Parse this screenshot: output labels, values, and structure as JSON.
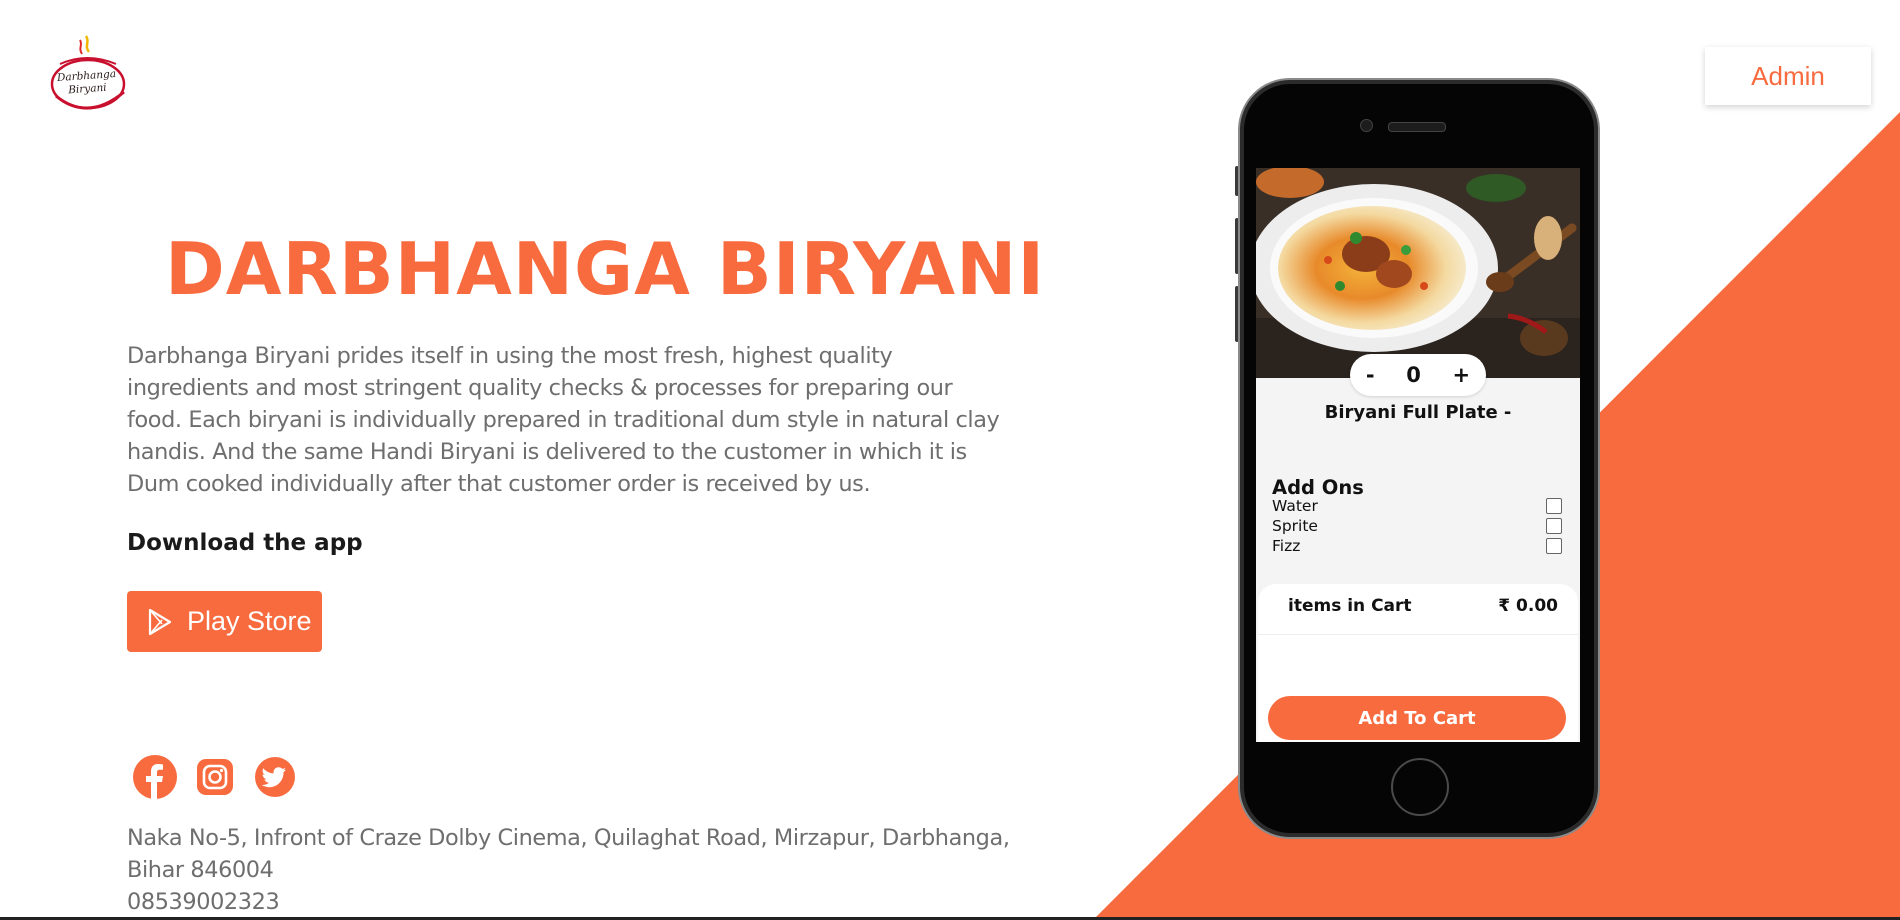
{
  "colors": {
    "accent": "#f86b3f",
    "text_muted": "#6e6e6e",
    "text_dark": "#1a1a1a"
  },
  "logo": {
    "line1": "Darbhanga",
    "line2": "Biryani",
    "icon": "handi-pot-logo"
  },
  "header": {
    "admin_label": "Admin"
  },
  "hero": {
    "title": "DARBHANGA BIRYANI",
    "description": "Darbhanga Biryani prides itself in using the most fresh, highest quality ingredients and most stringent quality checks & processes for preparing our food. Each biryani is individually prepared in traditional dum style in natural clay handis. And the same Handi Biryani is delivered to the customer in which it is Dum cooked individually after that customer order is received by us.",
    "download_label": "Download the app",
    "play_store_label": "Play Store",
    "play_store_icon": "play-store-icon"
  },
  "socials": [
    {
      "name": "facebook",
      "icon": "facebook-icon"
    },
    {
      "name": "instagram",
      "icon": "instagram-icon"
    },
    {
      "name": "twitter",
      "icon": "twitter-icon"
    }
  ],
  "contact": {
    "address_line1": "Naka No-5, Infront of Craze Dolby Cinema, Quilaghat Road, Mirzapur, Darbhanga,",
    "address_line2": "Bihar 846004",
    "phone": "08539002323"
  },
  "phone_mockup": {
    "quantity": {
      "minus": "-",
      "value": "0",
      "plus": "+"
    },
    "item_title": "Biryani Full Plate -",
    "addons_title": "Add Ons",
    "addons": [
      {
        "label": "Water",
        "checked": false
      },
      {
        "label": "Sprite",
        "checked": false
      },
      {
        "label": "Fizz",
        "checked": false
      }
    ],
    "cart": {
      "items_label": "items in Cart",
      "total": "₹ 0.00"
    },
    "add_to_cart_label": "Add To Cart"
  }
}
